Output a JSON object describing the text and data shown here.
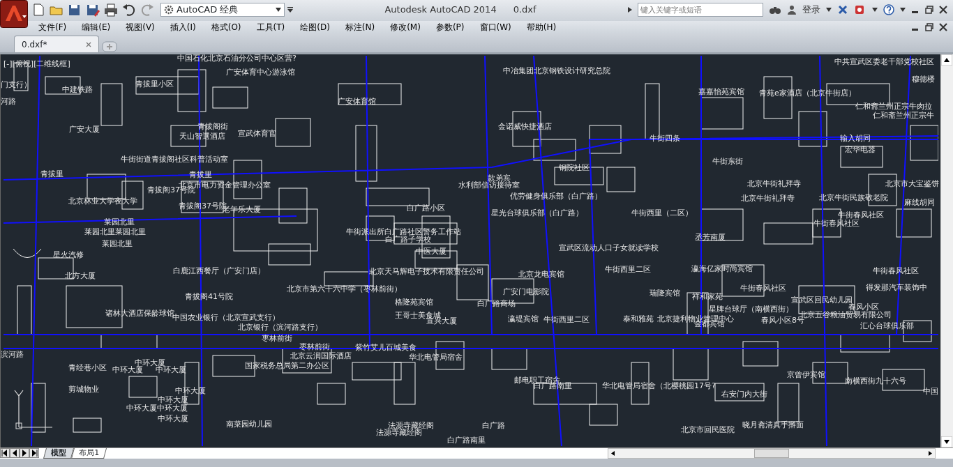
{
  "title_bar": {
    "workspace": "AutoCAD 经典",
    "title": "Autodesk AutoCAD 2014",
    "filename": "0.dxf",
    "search": {
      "placeholder": "键入关键字或短语"
    },
    "sign_in": "登录"
  },
  "menu": [
    "文件(F)",
    "编辑(E)",
    "视图(V)",
    "插入(I)",
    "格式(O)",
    "工具(T)",
    "绘图(D)",
    "标注(N)",
    "修改(M)",
    "参数(P)",
    "窗口(W)",
    "帮助(H)"
  ],
  "document_tabs": [
    {
      "label": "0.dxf*",
      "selected": true
    }
  ],
  "viewport_label": "[-][俯视][二维线框]",
  "map_labels": [
    "中国石化北京石油分公司中心区营?",
    "广安体育中心游泳馆",
    "门支行）",
    "青拔里小区",
    "中建铁路",
    "河路",
    "广安大厦",
    "青拔阁街",
    "天山智選酒店",
    "宣武体育官",
    "牛街街道青拔阁社区科普活动室",
    "青拔里",
    "青拔里",
    "北京市电力资金管理办公室",
    "青拔阁37号院",
    "北京林业大学夜大学",
    "青拔阁37号院",
    "老年乐大厦",
    "莱园北里",
    "莱园北里莱园北里",
    "莱园北里",
    "星火汽修",
    "广安体育馆",
    "中冶集团北京钢铁设计研究总院",
    "金诺威快捷酒店",
    "钢院社区",
    "款弟宾",
    "水利部信访接待室",
    "优劳健身俱乐部（白广路）",
    "白广路小区",
    "星光台球俱乐部（白广路）",
    "牛街派出所白广路社区警务工作站",
    "白广路子学校",
    "中医大厦",
    "宣武区流动人口子女就读学校",
    "中共宣武区委老干部党校社区",
    "穆德楼",
    "嘉嘉怡苑宾馆",
    "青苑e家酒店（北京牛街店）",
    "仁和斋兰州正宗牛肉拉",
    "仁和斋兰州正宗牛",
    "牛街四条",
    "输入胡同",
    "宏华电器",
    "牛街东街",
    "北京牛街礼拜寺",
    "北京市大宝鉴饼",
    "北京牛街礼拜寺",
    "北京牛街民族敬老院",
    "麻线胡同",
    "牛街西里（二区）",
    "牛街春风社区",
    "牛街春风社区",
    "丞芳南厦",
    "白鹿江西餐厅（广安门店）",
    "北京天马辉电子技术有限责任公司",
    "北方大厦",
    "北京市第六十六中学（枣林前街）",
    "青拔阁41号院",
    "格隆苑宾馆",
    "诸林大酒店保龄球馆",
    "中国农业银行（北京宣武支行）",
    "北京银行（滨河路支行）",
    "王哥士美食城",
    "宣兴大厦",
    "枣林前街",
    "枣林前街",
    "北京云润国际酒店",
    "紫竹艾儿百城美食",
    "华北电管局宿舍",
    "国家税务总局第二办公区",
    "滨河路",
    "青经巷小区",
    "中环大厦",
    "中环大厦",
    "中环大厦",
    "剪城物业",
    "中环大厦",
    "中环大厦",
    "中环大厦中环大厦",
    "中环大厦",
    "南菜园幼儿园",
    "法源寺藏经阁",
    "法源寺藏经阁",
    "白广路",
    "北京龙电宾馆",
    "广安门电影院",
    "白广路商场",
    "瀛堤宾馆",
    "牛街西里二区",
    "牛街西里二区",
    "瀛海亿家时尚宾馆",
    "牛街春风社区",
    "牛街春风社区",
    "得发那汽车装饰中",
    "祥和家苑",
    "瑞隆宾馆",
    "宣武区回民幼儿园",
    "星牌台球厅（南横西街）",
    "春风小区",
    "泰和雅苑",
    "北京捷利物业管理中心",
    "金都宾馆",
    "北京五谷粮油贸易有限公司",
    "春风小区8号",
    "汇心台球俱乐部",
    "京曾伊宾馆",
    "南横西街九十六号",
    "右安门内大街",
    "晓月斋清真手擀面",
    "北京市回民医院",
    "华北电管局宿舍（北樱桃园17号?",
    "邮电职工宿舍",
    "白广路南里",
    "中国",
    "白广路南里"
  ],
  "layout_tabs": [
    {
      "label": "模型",
      "selected": true
    },
    {
      "label": "布局1",
      "selected": false
    }
  ]
}
